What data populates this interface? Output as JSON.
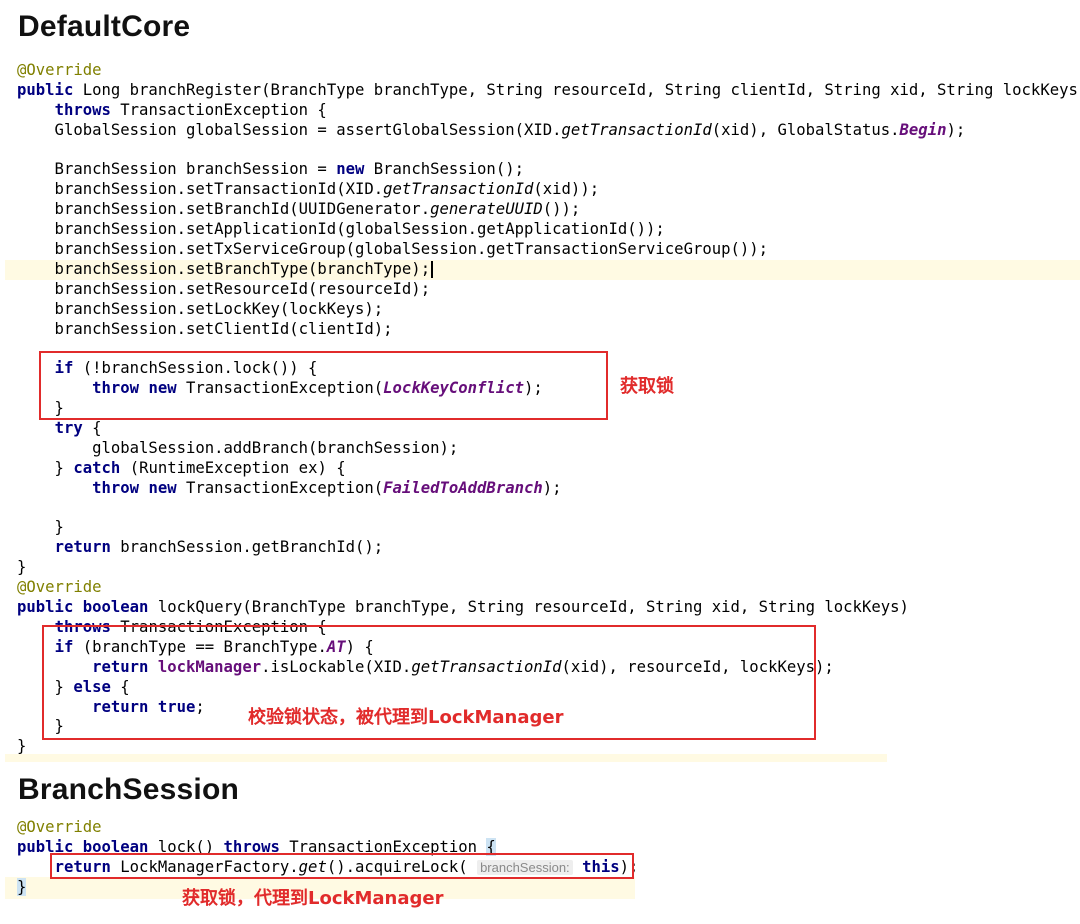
{
  "sections": {
    "default_core": {
      "title": "DefaultCore",
      "lines": [
        [
          {
            "t": "@Override",
            "c": "ann"
          }
        ],
        [
          {
            "t": "public ",
            "c": "kw"
          },
          {
            "t": "Long branchRegister(BranchType branchType, String resourceId, String clientId, String xid, String lockKeys)"
          }
        ],
        [
          {
            "t": "    "
          },
          {
            "t": "throws ",
            "c": "kw"
          },
          {
            "t": "TransactionException {"
          }
        ],
        [
          {
            "t": "    GlobalSession globalSession = assertGlobalSession(XID."
          },
          {
            "t": "getTransactionId",
            "c": "it"
          },
          {
            "t": "(xid), GlobalStatus."
          },
          {
            "t": "Begin",
            "c": "cst"
          },
          {
            "t": ");"
          }
        ],
        [
          {
            "t": ""
          }
        ],
        [
          {
            "t": "    BranchSession branchSession = "
          },
          {
            "t": "new ",
            "c": "kw"
          },
          {
            "t": "BranchSession();"
          }
        ],
        [
          {
            "t": "    branchSession.setTransactionId(XID."
          },
          {
            "t": "getTransactionId",
            "c": "it"
          },
          {
            "t": "(xid));"
          }
        ],
        [
          {
            "t": "    branchSession.setBranchId(UUIDGenerator."
          },
          {
            "t": "generateUUID",
            "c": "it"
          },
          {
            "t": "());"
          }
        ],
        [
          {
            "t": "    branchSession.setApplicationId(globalSession.getApplicationId());"
          }
        ],
        [
          {
            "t": "    branchSession.setTxServiceGroup(globalSession.getTransactionServiceGroup());"
          }
        ],
        [
          {
            "t": "    branchSession.setBranchType(branchType);"
          }
        ],
        [
          {
            "t": "    branchSession.setResourceId(resourceId);"
          }
        ],
        [
          {
            "t": "    branchSession.setLockKey(lockKeys);"
          }
        ],
        [
          {
            "t": "    branchSession.setClientId(clientId);"
          }
        ],
        [
          {
            "t": ""
          }
        ],
        [
          {
            "t": "    "
          },
          {
            "t": "if ",
            "c": "kw"
          },
          {
            "t": "(!branchSession.lock()) {"
          }
        ],
        [
          {
            "t": "        "
          },
          {
            "t": "throw new ",
            "c": "kw"
          },
          {
            "t": "TransactionException("
          },
          {
            "t": "LockKeyConflict",
            "c": "cst"
          },
          {
            "t": ");"
          }
        ],
        [
          {
            "t": "    }"
          }
        ],
        [
          {
            "t": "    "
          },
          {
            "t": "try ",
            "c": "kw"
          },
          {
            "t": "{"
          }
        ],
        [
          {
            "t": "        globalSession.addBranch(branchSession);"
          }
        ],
        [
          {
            "t": "    } "
          },
          {
            "t": "catch ",
            "c": "kw"
          },
          {
            "t": "(RuntimeException ex) {"
          }
        ],
        [
          {
            "t": "        "
          },
          {
            "t": "throw new ",
            "c": "kw"
          },
          {
            "t": "TransactionException("
          },
          {
            "t": "FailedToAddBranch",
            "c": "cst"
          },
          {
            "t": ");"
          }
        ],
        [
          {
            "t": ""
          }
        ],
        [
          {
            "t": "    }"
          }
        ],
        [
          {
            "t": "    "
          },
          {
            "t": "return ",
            "c": "kw"
          },
          {
            "t": "branchSession.getBranchId();"
          }
        ],
        [
          {
            "t": "}"
          }
        ],
        [
          {
            "t": "@Override",
            "c": "ann"
          }
        ],
        [
          {
            "t": "public boolean ",
            "c": "kw"
          },
          {
            "t": "lockQuery(BranchType branchType, String resourceId, String xid, String lockKeys)"
          }
        ],
        [
          {
            "t": "    "
          },
          {
            "t": "throws ",
            "c": "kw"
          },
          {
            "t": "TransactionException {"
          }
        ],
        [
          {
            "t": "    "
          },
          {
            "t": "if ",
            "c": "kw"
          },
          {
            "t": "(branchType == BranchType."
          },
          {
            "t": "AT",
            "c": "cst"
          },
          {
            "t": ") {"
          }
        ],
        [
          {
            "t": "        "
          },
          {
            "t": "return ",
            "c": "kw"
          },
          {
            "t": "lockManager",
            "c": "fld"
          },
          {
            "t": ".isLockable(XID."
          },
          {
            "t": "getTransactionId",
            "c": "it"
          },
          {
            "t": "(xid), resourceId, lockKeys);"
          }
        ],
        [
          {
            "t": "    } "
          },
          {
            "t": "else ",
            "c": "kw"
          },
          {
            "t": "{"
          }
        ],
        [
          {
            "t": "        "
          },
          {
            "t": "return true",
            "c": "kw"
          },
          {
            "t": ";"
          }
        ],
        [
          {
            "t": "    }"
          }
        ],
        [
          {
            "t": "}"
          }
        ]
      ]
    },
    "branch_session": {
      "title": "BranchSession",
      "lines": [
        [
          {
            "t": "@Override",
            "c": "ann"
          }
        ],
        [
          {
            "t": "public boolean ",
            "c": "kw"
          },
          {
            "t": "lock() "
          },
          {
            "t": "throws ",
            "c": "kw"
          },
          {
            "t": "TransactionException "
          },
          {
            "t": "{",
            "c": "brace-hl"
          }
        ],
        [
          {
            "t": "    "
          },
          {
            "t": "return ",
            "c": "kw"
          },
          {
            "t": "LockManagerFactory."
          },
          {
            "t": "get",
            "c": "it"
          },
          {
            "t": "().acquireLock( "
          },
          {
            "t": "branchSession:",
            "c": "hint"
          },
          {
            "t": " "
          },
          {
            "t": "this",
            "c": "kw"
          },
          {
            "t": ");"
          }
        ],
        [
          {
            "t": "}",
            "c": "brace-hl"
          }
        ]
      ]
    }
  },
  "annotations": {
    "acquire_lock": "获取锁",
    "check_lock_state": "校验锁状态，被代理到LockManager",
    "acquire_lock_proxy": "获取锁，代理到LockManager"
  },
  "colors": {
    "keyword": "#000080",
    "annotation": "#808000",
    "constant": "#660e7a",
    "highlight_box": "#e12b2b",
    "current_line": "#fffae3"
  }
}
